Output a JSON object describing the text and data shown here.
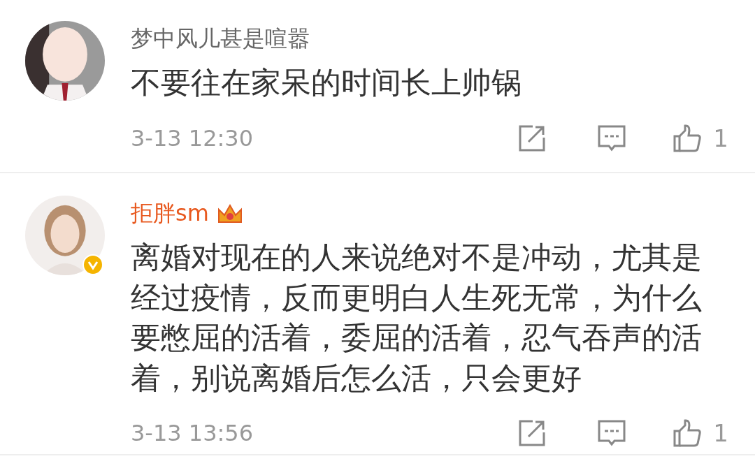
{
  "comments": [
    {
      "username": "梦中风儿甚是喧嚣",
      "vip": false,
      "verified": false,
      "text": "不要往在家呆的时间长上帅锅",
      "time": "3-13 12:30",
      "likes": "1"
    },
    {
      "username": "拒胖sm",
      "vip": true,
      "verified": true,
      "text": "离婚对现在的人来说绝对不是冲动，尤其是经过疫情，反而更明白人生死无常，为什么要憋屈的活着，委屈的活着，忍气吞声的活着，别说离婚后怎么活，只会更好",
      "time": "3-13 13:56",
      "likes": "1"
    }
  ]
}
